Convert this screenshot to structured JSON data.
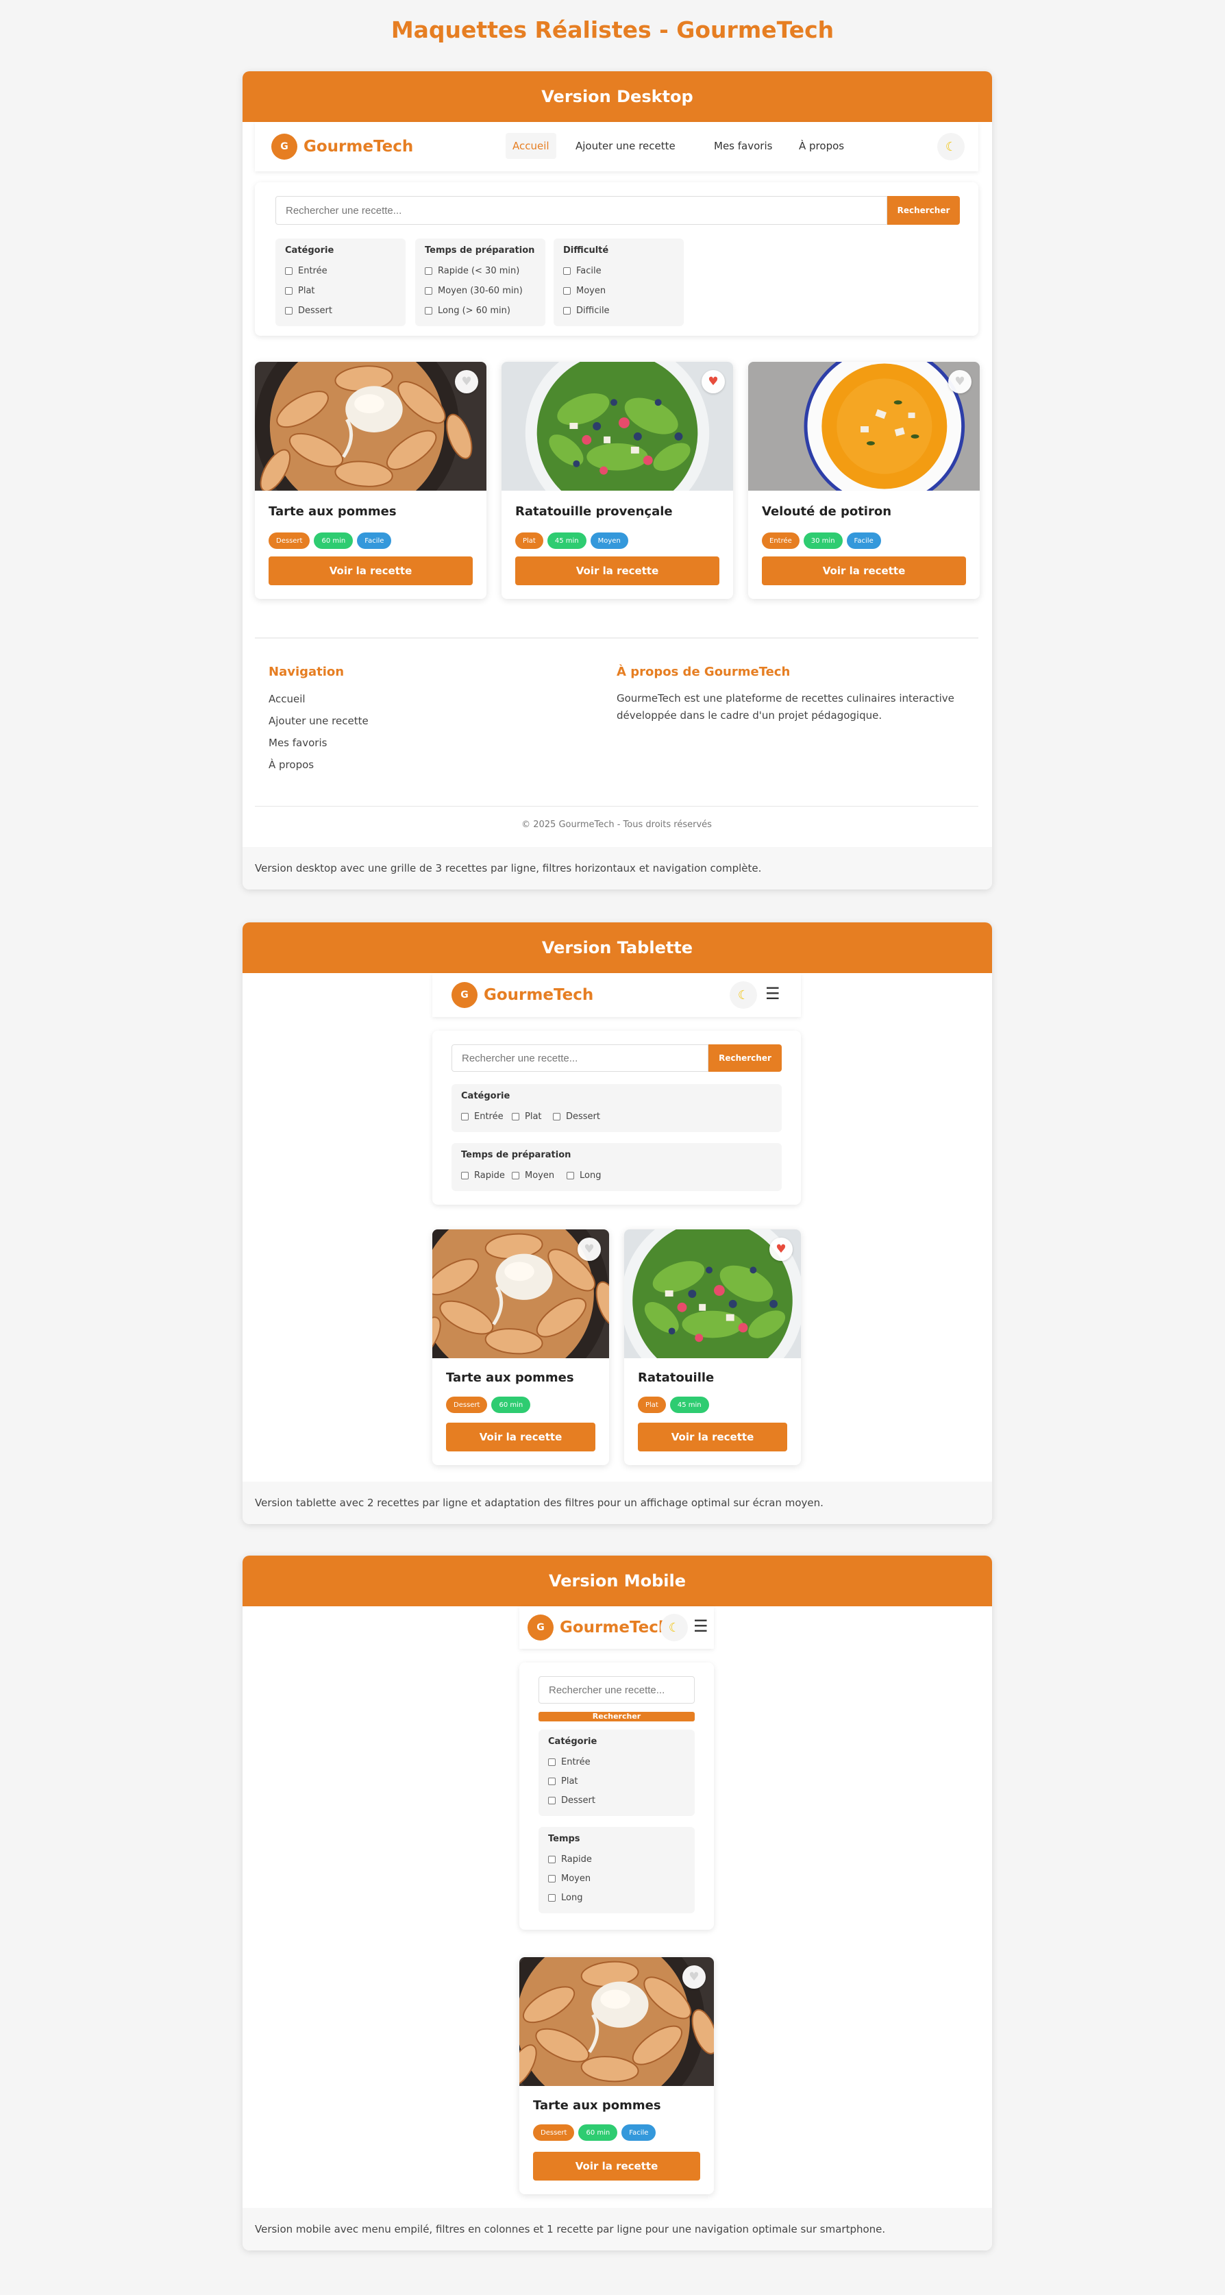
{
  "page_title": "Maquettes Réalistes - GourmeTech",
  "brand": {
    "initial": "G",
    "name": "GourmeTech"
  },
  "colors": {
    "accent": "#e67e22",
    "green": "#2ecc71",
    "blue": "#3498db",
    "heart_active": "#e74c3c"
  },
  "icons": {
    "theme_toggle": "moon-icon",
    "menu": "hamburger-icon",
    "favorite": "heart-icon"
  },
  "search": {
    "placeholder": "Rechercher une recette...",
    "button": "Rechercher"
  },
  "desktop": {
    "header": "Version Desktop",
    "nav": [
      {
        "label": "Accueil",
        "active": true
      },
      {
        "label": "Ajouter une recette"
      },
      {
        "label": "Mes favoris"
      },
      {
        "label": "À propos"
      }
    ],
    "filters": [
      {
        "title": "Catégorie",
        "options": [
          "Entrée",
          "Plat",
          "Dessert"
        ]
      },
      {
        "title": "Temps de préparation",
        "options": [
          "Rapide (< 30 min)",
          "Moyen (30-60 min)",
          "Long (> 60 min)"
        ]
      },
      {
        "title": "Difficulté",
        "options": [
          "Facile",
          "Moyen",
          "Difficile"
        ]
      }
    ],
    "cards": [
      {
        "title": "Tarte aux pommes",
        "tags": [
          "Dessert",
          "60 min",
          "Facile"
        ],
        "cta": "Voir la recette",
        "favorite": false
      },
      {
        "title": "Ratatouille provençale",
        "tags": [
          "Plat",
          "45 min",
          "Moyen"
        ],
        "cta": "Voir la recette",
        "favorite": true
      },
      {
        "title": "Velouté de potiron",
        "tags": [
          "Entrée",
          "30 min",
          "Facile"
        ],
        "cta": "Voir la recette",
        "favorite": false
      }
    ],
    "footer": {
      "nav_title": "Navigation",
      "links": [
        "Accueil",
        "Ajouter une recette",
        "Mes favoris",
        "À propos"
      ],
      "about_title": "À propos de GourmeTech",
      "about_line1": "GourmeTech est une plateforme de recettes culinaires interactive",
      "about_line2": "développée dans le cadre d'un projet pédagogique.",
      "copyright": "© 2025 GourmeTech - Tous droits réservés"
    },
    "caption": "Version desktop avec une grille de 3 recettes par ligne, filtres horizontaux et navigation complète."
  },
  "tablet": {
    "header": "Version Tablette",
    "filters": [
      {
        "title": "Catégorie",
        "options": [
          "Entrée",
          "Plat",
          "Dessert"
        ]
      },
      {
        "title": "Temps de préparation",
        "options": [
          "Rapide",
          "Moyen",
          "Long"
        ]
      }
    ],
    "cards": [
      {
        "title": "Tarte aux pommes",
        "tags": [
          "Dessert",
          "60 min"
        ],
        "cta": "Voir la recette",
        "favorite": false
      },
      {
        "title": "Ratatouille",
        "tags": [
          "Plat",
          "45 min"
        ],
        "cta": "Voir la recette",
        "favorite": true
      }
    ],
    "caption": "Version tablette avec 2 recettes par ligne et adaptation des filtres pour un affichage optimal sur écran moyen."
  },
  "mobile": {
    "header": "Version Mobile",
    "filters": [
      {
        "title": "Catégorie",
        "options": [
          "Entrée",
          "Plat",
          "Dessert"
        ]
      },
      {
        "title": "Temps",
        "options": [
          "Rapide",
          "Moyen",
          "Long"
        ]
      }
    ],
    "cards": [
      {
        "title": "Tarte aux pommes",
        "tags": [
          "Dessert",
          "60 min",
          "Facile"
        ],
        "cta": "Voir la recette",
        "favorite": false
      }
    ],
    "caption": "Version mobile avec menu empilé, filtres en colonnes et 1 recette par ligne pour une navigation optimale sur smartphone."
  }
}
